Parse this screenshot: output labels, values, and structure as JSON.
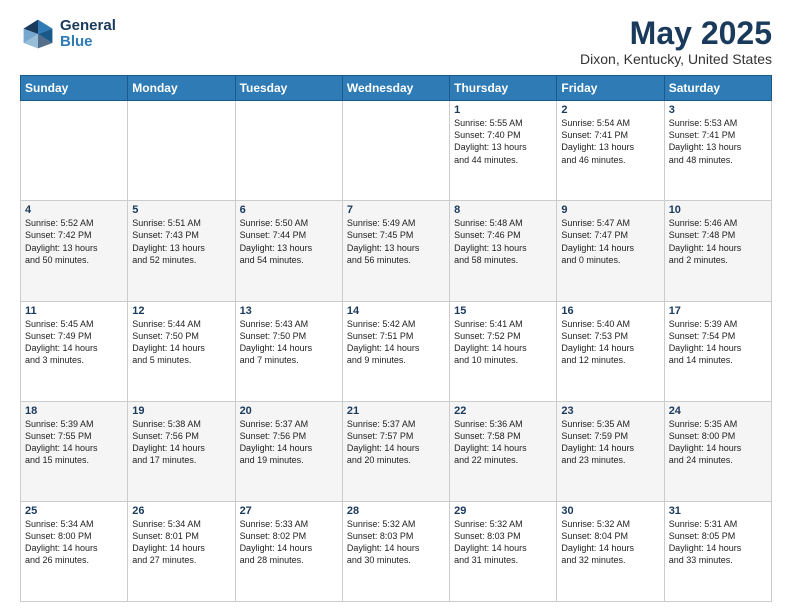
{
  "header": {
    "logo_general": "General",
    "logo_blue": "Blue",
    "title": "May 2025",
    "location": "Dixon, Kentucky, United States"
  },
  "weekdays": [
    "Sunday",
    "Monday",
    "Tuesday",
    "Wednesday",
    "Thursday",
    "Friday",
    "Saturday"
  ],
  "weeks": [
    [
      {
        "day": "",
        "text": ""
      },
      {
        "day": "",
        "text": ""
      },
      {
        "day": "",
        "text": ""
      },
      {
        "day": "",
        "text": ""
      },
      {
        "day": "1",
        "text": "Sunrise: 5:55 AM\nSunset: 7:40 PM\nDaylight: 13 hours\nand 44 minutes."
      },
      {
        "day": "2",
        "text": "Sunrise: 5:54 AM\nSunset: 7:41 PM\nDaylight: 13 hours\nand 46 minutes."
      },
      {
        "day": "3",
        "text": "Sunrise: 5:53 AM\nSunset: 7:41 PM\nDaylight: 13 hours\nand 48 minutes."
      }
    ],
    [
      {
        "day": "4",
        "text": "Sunrise: 5:52 AM\nSunset: 7:42 PM\nDaylight: 13 hours\nand 50 minutes."
      },
      {
        "day": "5",
        "text": "Sunrise: 5:51 AM\nSunset: 7:43 PM\nDaylight: 13 hours\nand 52 minutes."
      },
      {
        "day": "6",
        "text": "Sunrise: 5:50 AM\nSunset: 7:44 PM\nDaylight: 13 hours\nand 54 minutes."
      },
      {
        "day": "7",
        "text": "Sunrise: 5:49 AM\nSunset: 7:45 PM\nDaylight: 13 hours\nand 56 minutes."
      },
      {
        "day": "8",
        "text": "Sunrise: 5:48 AM\nSunset: 7:46 PM\nDaylight: 13 hours\nand 58 minutes."
      },
      {
        "day": "9",
        "text": "Sunrise: 5:47 AM\nSunset: 7:47 PM\nDaylight: 14 hours\nand 0 minutes."
      },
      {
        "day": "10",
        "text": "Sunrise: 5:46 AM\nSunset: 7:48 PM\nDaylight: 14 hours\nand 2 minutes."
      }
    ],
    [
      {
        "day": "11",
        "text": "Sunrise: 5:45 AM\nSunset: 7:49 PM\nDaylight: 14 hours\nand 3 minutes."
      },
      {
        "day": "12",
        "text": "Sunrise: 5:44 AM\nSunset: 7:50 PM\nDaylight: 14 hours\nand 5 minutes."
      },
      {
        "day": "13",
        "text": "Sunrise: 5:43 AM\nSunset: 7:50 PM\nDaylight: 14 hours\nand 7 minutes."
      },
      {
        "day": "14",
        "text": "Sunrise: 5:42 AM\nSunset: 7:51 PM\nDaylight: 14 hours\nand 9 minutes."
      },
      {
        "day": "15",
        "text": "Sunrise: 5:41 AM\nSunset: 7:52 PM\nDaylight: 14 hours\nand 10 minutes."
      },
      {
        "day": "16",
        "text": "Sunrise: 5:40 AM\nSunset: 7:53 PM\nDaylight: 14 hours\nand 12 minutes."
      },
      {
        "day": "17",
        "text": "Sunrise: 5:39 AM\nSunset: 7:54 PM\nDaylight: 14 hours\nand 14 minutes."
      }
    ],
    [
      {
        "day": "18",
        "text": "Sunrise: 5:39 AM\nSunset: 7:55 PM\nDaylight: 14 hours\nand 15 minutes."
      },
      {
        "day": "19",
        "text": "Sunrise: 5:38 AM\nSunset: 7:56 PM\nDaylight: 14 hours\nand 17 minutes."
      },
      {
        "day": "20",
        "text": "Sunrise: 5:37 AM\nSunset: 7:56 PM\nDaylight: 14 hours\nand 19 minutes."
      },
      {
        "day": "21",
        "text": "Sunrise: 5:37 AM\nSunset: 7:57 PM\nDaylight: 14 hours\nand 20 minutes."
      },
      {
        "day": "22",
        "text": "Sunrise: 5:36 AM\nSunset: 7:58 PM\nDaylight: 14 hours\nand 22 minutes."
      },
      {
        "day": "23",
        "text": "Sunrise: 5:35 AM\nSunset: 7:59 PM\nDaylight: 14 hours\nand 23 minutes."
      },
      {
        "day": "24",
        "text": "Sunrise: 5:35 AM\nSunset: 8:00 PM\nDaylight: 14 hours\nand 24 minutes."
      }
    ],
    [
      {
        "day": "25",
        "text": "Sunrise: 5:34 AM\nSunset: 8:00 PM\nDaylight: 14 hours\nand 26 minutes."
      },
      {
        "day": "26",
        "text": "Sunrise: 5:34 AM\nSunset: 8:01 PM\nDaylight: 14 hours\nand 27 minutes."
      },
      {
        "day": "27",
        "text": "Sunrise: 5:33 AM\nSunset: 8:02 PM\nDaylight: 14 hours\nand 28 minutes."
      },
      {
        "day": "28",
        "text": "Sunrise: 5:32 AM\nSunset: 8:03 PM\nDaylight: 14 hours\nand 30 minutes."
      },
      {
        "day": "29",
        "text": "Sunrise: 5:32 AM\nSunset: 8:03 PM\nDaylight: 14 hours\nand 31 minutes."
      },
      {
        "day": "30",
        "text": "Sunrise: 5:32 AM\nSunset: 8:04 PM\nDaylight: 14 hours\nand 32 minutes."
      },
      {
        "day": "31",
        "text": "Sunrise: 5:31 AM\nSunset: 8:05 PM\nDaylight: 14 hours\nand 33 minutes."
      }
    ]
  ]
}
